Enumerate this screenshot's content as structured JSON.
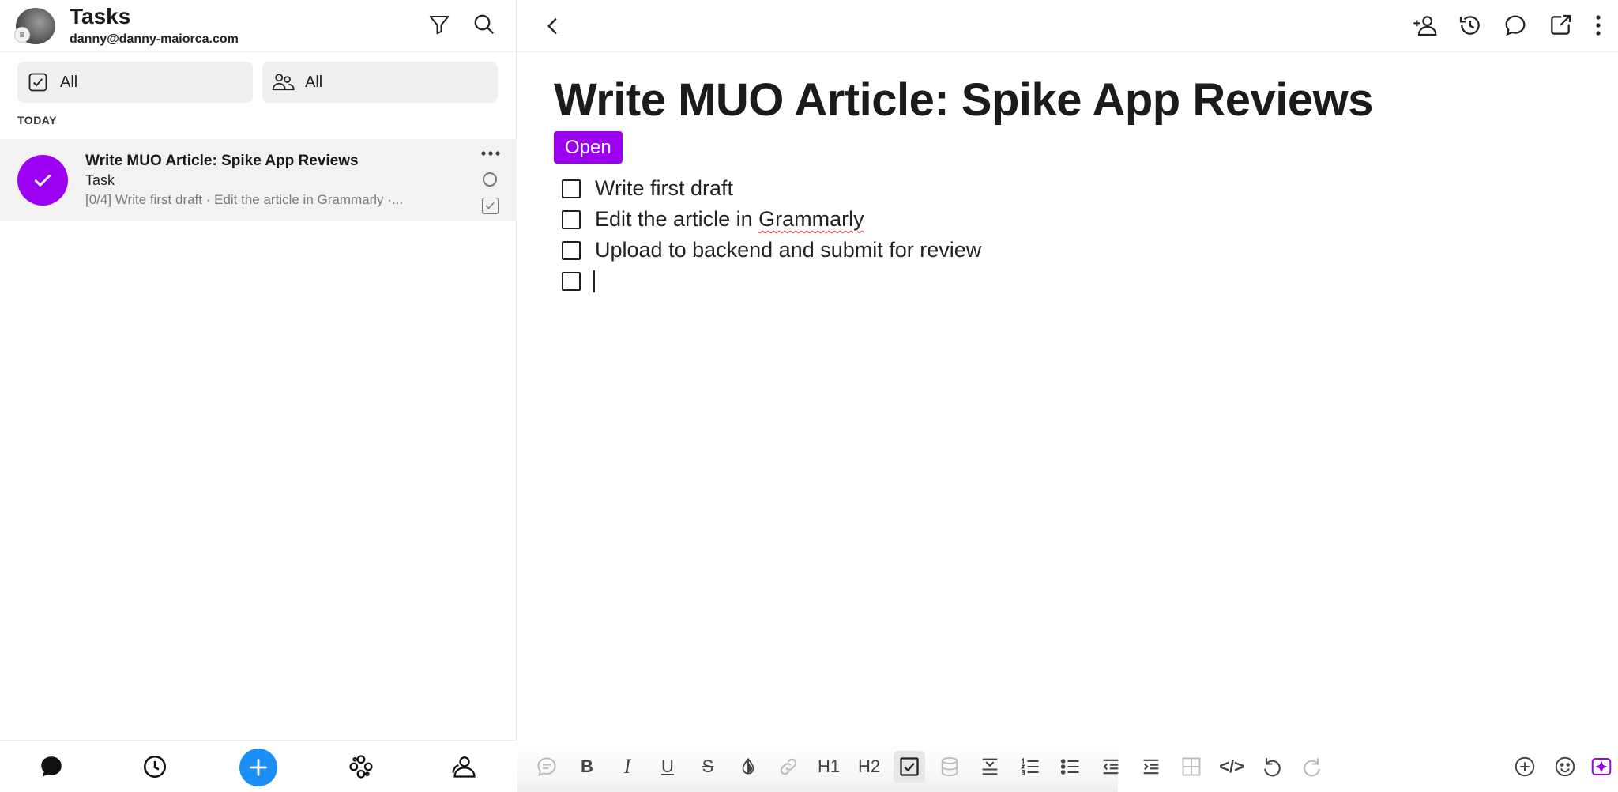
{
  "list_header": {
    "title": "Tasks",
    "email": "danny@danny-maiorca.com"
  },
  "filters": [
    {
      "label": "All",
      "icon": "checkbox-icon"
    },
    {
      "label": "All",
      "icon": "people-icon"
    }
  ],
  "section_label": "TODAY",
  "task": {
    "title": "Write MUO Article: Spike App Reviews",
    "type": "Task",
    "preview": "[0/4] Write first draft · Edit the article in Grammarly ·..."
  },
  "detail": {
    "title": "Write MUO Article: Spike App Reviews",
    "status": "Open",
    "checklist": [
      {
        "text": "Write first draft",
        "checked": false
      },
      {
        "text": "Edit the article in ",
        "spell_word": "Grammarly",
        "checked": false
      },
      {
        "text": "Upload to backend and submit for review",
        "checked": false
      },
      {
        "text": "",
        "checked": false
      }
    ]
  },
  "toolbar": {
    "bold": "B",
    "italic": "I",
    "underline": "U",
    "strike": "S",
    "h1": "H1",
    "h2": "H2",
    "code": "</>"
  },
  "colors": {
    "accent_purple": "#9b00f0",
    "fab_blue": "#1a8ff5"
  }
}
